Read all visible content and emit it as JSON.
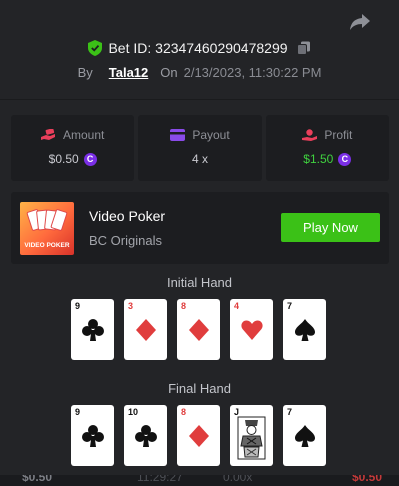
{
  "bet": {
    "id_label": "Bet ID: 32347460290478299",
    "by_label": "By",
    "username": "Tala12",
    "on_label": "On",
    "datetime": "2/13/2023, 11:30:22 PM"
  },
  "stats": [
    {
      "label": "Amount",
      "value": "$0.50",
      "icon": "money-hand-icon",
      "value_color": "#c9cad0"
    },
    {
      "label": "Payout",
      "value": "4 x",
      "icon": "card-payout-icon",
      "value_color": "#c9cad0"
    },
    {
      "label": "Profit",
      "value": "$1.50",
      "icon": "profit-icon",
      "value_color": "#3fd13f"
    }
  ],
  "coin_symbol": "C",
  "game": {
    "name": "Video Poker",
    "provider": "BC Originals",
    "thumb_label": "VIDEO POKER",
    "play_label": "Play Now"
  },
  "initial_hand": {
    "title": "Initial Hand",
    "cards": [
      {
        "rank": "9",
        "suit": "club",
        "color": "black"
      },
      {
        "rank": "3",
        "suit": "diamond",
        "color": "red"
      },
      {
        "rank": "8",
        "suit": "diamond",
        "color": "red"
      },
      {
        "rank": "4",
        "suit": "heart",
        "color": "red"
      },
      {
        "rank": "7",
        "suit": "spade",
        "color": "black"
      }
    ]
  },
  "final_hand": {
    "title": "Final Hand",
    "cards": [
      {
        "rank": "9",
        "suit": "club",
        "color": "black"
      },
      {
        "rank": "10",
        "suit": "club",
        "color": "black"
      },
      {
        "rank": "8",
        "suit": "diamond",
        "color": "red"
      },
      {
        "rank": "J",
        "suit": "jack-face",
        "color": "black"
      },
      {
        "rank": "7",
        "suit": "spade",
        "color": "black"
      }
    ]
  },
  "background_row": {
    "left": "$0.50",
    "middle_time": "11:29:27",
    "middle_mult": "0.00x",
    "right": "$0.50"
  },
  "colors": {
    "background": "#232427",
    "panel": "#1c1d20",
    "accent_green": "#3bc117",
    "coin_purple": "#7a2ee6",
    "loss_red": "#e03d3d"
  }
}
